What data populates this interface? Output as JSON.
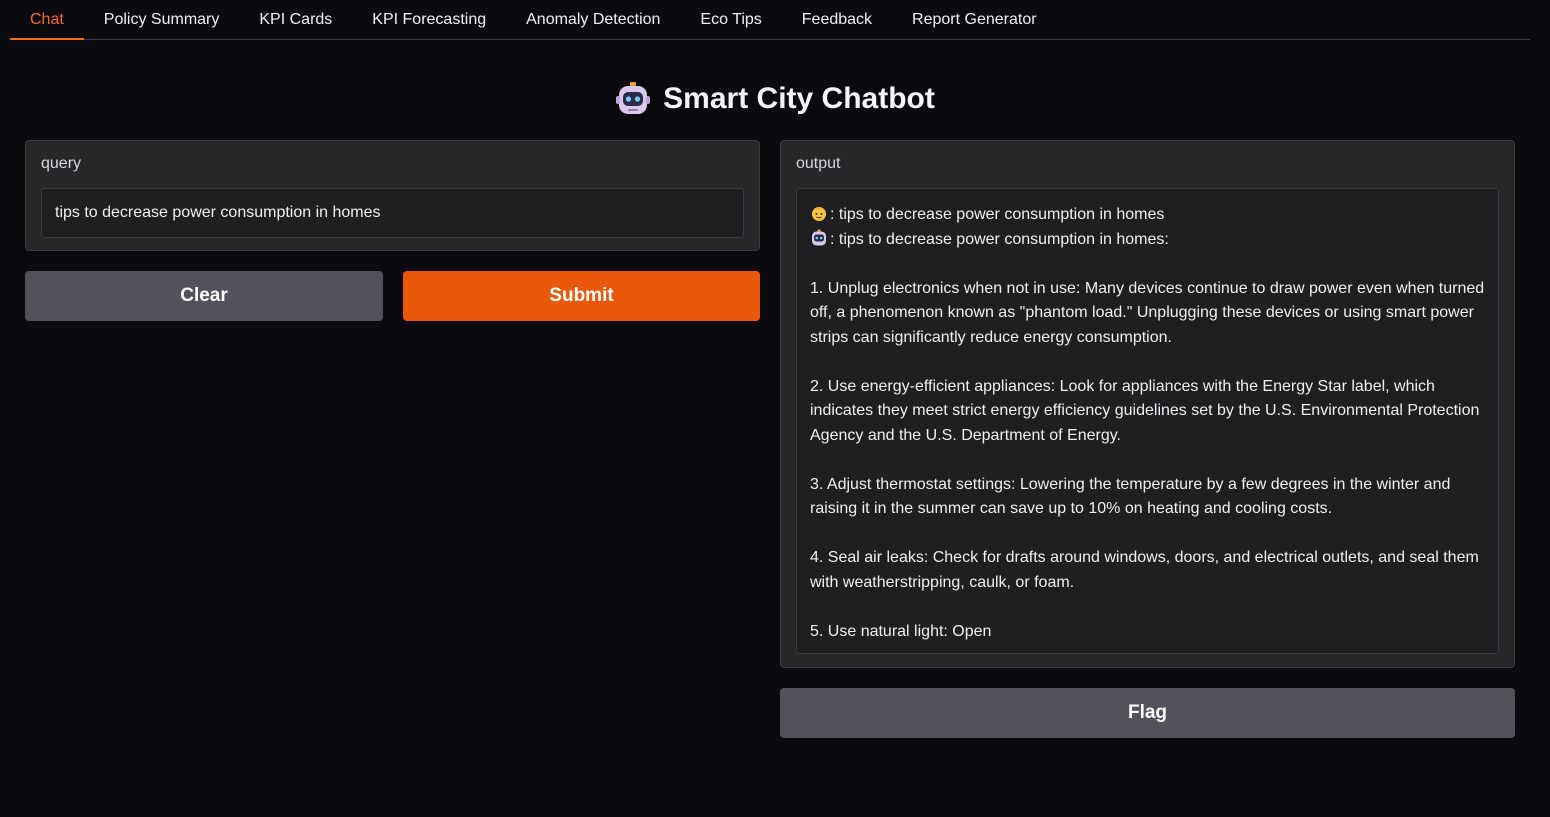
{
  "tabs": [
    {
      "label": "Chat",
      "active": true
    },
    {
      "label": "Policy Summary",
      "active": false
    },
    {
      "label": "KPI Cards",
      "active": false
    },
    {
      "label": "KPI Forecasting",
      "active": false
    },
    {
      "label": "Anomaly Detection",
      "active": false
    },
    {
      "label": "Eco Tips",
      "active": false
    },
    {
      "label": "Feedback",
      "active": false
    },
    {
      "label": "Report Generator",
      "active": false
    }
  ],
  "header": {
    "title": "Smart City Chatbot",
    "icon": "robot-icon"
  },
  "query": {
    "label": "query",
    "value": "tips to decrease power consumption in homes"
  },
  "buttons": {
    "clear": "Clear",
    "submit": "Submit",
    "flag": "Flag"
  },
  "output": {
    "label": "output",
    "user_line": ": tips to decrease power consumption in homes",
    "bot_line": ": tips to decrease power consumption in homes:",
    "tips": [
      "1. Unplug electronics when not in use: Many devices continue to draw power even when turned off, a phenomenon known as \"phantom load.\" Unplugging these devices or using smart power strips can significantly reduce energy consumption.",
      "2. Use energy-efficient appliances: Look for appliances with the Energy Star label, which indicates they meet strict energy efficiency guidelines set by the U.S. Environmental Protection Agency and the U.S. Department of Energy.",
      "3. Adjust thermostat settings: Lowering the temperature by a few degrees in the winter and raising it in the summer can save up to 10% on heating and cooling costs.",
      "4. Seal air leaks: Check for drafts around windows, doors, and electrical outlets, and seal them with weatherstripping, caulk, or foam.",
      "5. Use natural light: Open"
    ]
  },
  "colors": {
    "accent": "#ea580c",
    "active_tab": "#f06a26",
    "secondary_button": "#52525b",
    "background": "#0b0b0f",
    "panel": "#27272a"
  }
}
